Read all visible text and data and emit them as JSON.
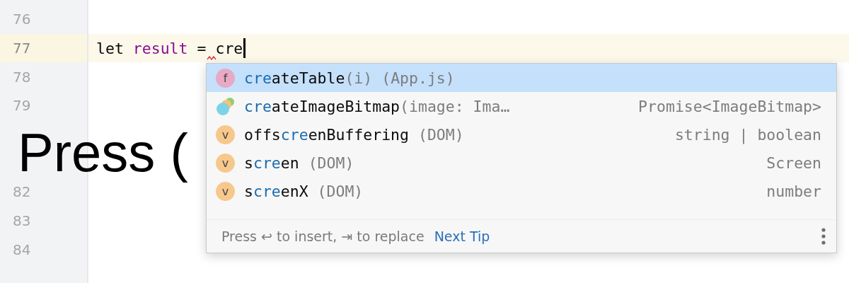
{
  "gutter": {
    "line_numbers": [
      {
        "number": "76",
        "current": false
      },
      {
        "number": "77",
        "current": true
      },
      {
        "number": "78",
        "current": false
      },
      {
        "number": "79",
        "current": false
      },
      {
        "current": false
      },
      {
        "current": false
      },
      {
        "number": "82",
        "current": false
      },
      {
        "number": "83",
        "current": false
      },
      {
        "number": "84",
        "current": false
      }
    ]
  },
  "editor": {
    "current_line_tokens": [
      {
        "text": "let",
        "kind": "keyword"
      },
      {
        "text": "result",
        "kind": "variable"
      },
      {
        "text": "=",
        "kind": "operator"
      },
      {
        "text": "cre",
        "kind": "typed",
        "error": true
      }
    ]
  },
  "completion_popup": {
    "items": [
      {
        "kind": "function",
        "icon_letter": "f",
        "match": "cre",
        "rest": "ateTable",
        "detail": "(i) (App.js)",
        "selected": true
      },
      {
        "kind": "method",
        "match": "cre",
        "rest": "ateImageBitmap",
        "detail": "(image: Ima…",
        "type": "Promise<ImageBitmap>",
        "selected": false
      },
      {
        "kind": "variable",
        "icon_letter": "v",
        "prefix": "offs",
        "match": "cre",
        "rest": "enBuffering",
        "detail": " (DOM)",
        "type": "string | boolean",
        "selected": false
      },
      {
        "kind": "variable",
        "icon_letter": "v",
        "prefix": "s",
        "match": "cre",
        "rest": "en",
        "detail": " (DOM)",
        "type": "Screen",
        "selected": false
      },
      {
        "kind": "variable",
        "icon_letter": "v",
        "prefix": "s",
        "match": "cre",
        "rest": "enX",
        "detail": " (DOM)",
        "type": "number",
        "selected": false
      }
    ],
    "footer": {
      "hint": "Press ↩ to insert, ⇥ to replace",
      "link": "Next Tip"
    }
  },
  "caption": "Press ("
}
